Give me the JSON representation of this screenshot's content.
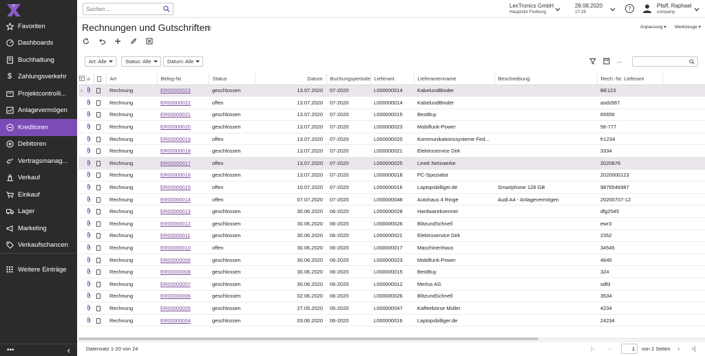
{
  "sidebar": {
    "items": [
      {
        "label": "Favoriten",
        "icon": "star-icon",
        "active": false
      },
      {
        "label": "Dashboards",
        "icon": "dashboard-icon",
        "active": false
      },
      {
        "label": "Buchhaltung",
        "icon": "ledger-icon",
        "active": false
      },
      {
        "label": "Zahlungsverkehr",
        "icon": "dollar-icon",
        "active": false
      },
      {
        "label": "Projektcontrolli...",
        "icon": "projects-icon",
        "active": false
      },
      {
        "label": "Anlagevermögen",
        "icon": "assets-icon",
        "active": false
      },
      {
        "label": "Kreditoren",
        "icon": "minus-circle-icon",
        "active": true
      },
      {
        "label": "Debitoren",
        "icon": "plus-circle-icon",
        "active": false
      },
      {
        "label": "Vertragsmanag...",
        "icon": "contract-icon",
        "active": false
      },
      {
        "label": "Verkauf",
        "icon": "sales-icon",
        "active": false
      },
      {
        "label": "Einkauf",
        "icon": "cart-icon",
        "active": false
      },
      {
        "label": "Lager",
        "icon": "truck-icon",
        "active": false
      },
      {
        "label": "Marketing",
        "icon": "megaphone-icon",
        "active": false
      },
      {
        "label": "Verkaufschancen",
        "icon": "tag-icon",
        "active": false
      }
    ],
    "more_label": "Weitere Einträge",
    "bottom_dots": "•••",
    "collapse": "‹"
  },
  "topbar": {
    "search_placeholder": "Suchen ...",
    "company": "LexTronics GmbH",
    "branch": "Hauptsitz Freiburg",
    "date": "28.08.2020",
    "time": "17:25",
    "help": "?",
    "user_name": "Pfaff, Raphael",
    "user_company": "company"
  },
  "page": {
    "title": "Rechnungen und Gutschriften",
    "star": "☆",
    "anpassung": "Anpassung",
    "werkzeuge": "Werkzeuge"
  },
  "filters": {
    "art": "Art: Alle",
    "status": "Status: Alle",
    "datum": "Datum: Alle"
  },
  "table": {
    "columns": [
      "Art",
      "Beleg-Nr.",
      "Status",
      "Datum",
      "Buchungsperiode",
      "Lieferant",
      "Lieferantenname",
      "Beschreibung",
      "Rech.-Nr. Lieferant"
    ],
    "rows": [
      {
        "art": "Rechnung",
        "beleg": "ER00000023",
        "status": "geschlossen",
        "datum": "13.07.2020",
        "periode": "07-2020",
        "lieferant": "L000000014",
        "name": "KabelundBinder",
        "beschreibung": "",
        "rechnr": "BE123",
        "sel": true
      },
      {
        "art": "Rechnung",
        "beleg": "ER00000022",
        "status": "offen",
        "datum": "13.07.2020",
        "periode": "07-2020",
        "lieferant": "L000000014",
        "name": "KabelundBinder",
        "beschreibung": "",
        "rechnr": "asds567",
        "sel": false
      },
      {
        "art": "Rechnung",
        "beleg": "ER00000021",
        "status": "geschlossen",
        "datum": "13.07.2020",
        "periode": "07-2020",
        "lieferant": "L000000015",
        "name": "BestBuy",
        "beschreibung": "",
        "rechnr": "65656",
        "sel": false
      },
      {
        "art": "Rechnung",
        "beleg": "ER00000020",
        "status": "geschlossen",
        "datum": "13.07.2020",
        "periode": "07-2020",
        "lieferant": "L000000023",
        "name": "Mobilfunk-Power",
        "beschreibung": "",
        "rechnr": "56-777",
        "sel": false
      },
      {
        "art": "Rechnung",
        "beleg": "ER00000019",
        "status": "offen",
        "datum": "13.07.2020",
        "periode": "07-2020",
        "lieferant": "L000000020",
        "name": "Kommunikationssysteme Fede...",
        "beschreibung": "",
        "rechnr": "fr1234",
        "sel": false
      },
      {
        "art": "Rechnung",
        "beleg": "ER00000018",
        "status": "geschlossen",
        "datum": "13.07.2020",
        "periode": "07-2020",
        "lieferant": "L000000021",
        "name": "Elektroservice Dirk",
        "beschreibung": "",
        "rechnr": "3334",
        "sel": false
      },
      {
        "art": "Rechnung",
        "beleg": "ER00000017",
        "status": "offen",
        "datum": "13.07.2020",
        "periode": "07-2020",
        "lieferant": "L000000025",
        "name": "Line6 Netzwerke",
        "beschreibung": "",
        "rechnr": "2020876",
        "sel": true
      },
      {
        "art": "Rechnung",
        "beleg": "ER00000016",
        "status": "geschlossen",
        "datum": "13.07.2020",
        "periode": "07-2020",
        "lieferant": "L000000018",
        "name": "PC-Spezialist",
        "beschreibung": "",
        "rechnr": "2020000123",
        "sel": false
      },
      {
        "art": "Rechnung",
        "beleg": "ER00000015",
        "status": "offen",
        "datum": "10.07.2020",
        "periode": "07-2020",
        "lieferant": "L000000016",
        "name": "Laptopsbilliger.de",
        "beschreibung": "Smartphone 128 GB",
        "rechnr": "9876546987",
        "sel": false
      },
      {
        "art": "Rechnung",
        "beleg": "ER00000014",
        "status": "offen",
        "datum": "07.07.2020",
        "periode": "07-2020",
        "lieferant": "L000000048",
        "name": "Autohaus 4 Ringe",
        "beschreibung": "Audi A4 - Anlagevermögen",
        "rechnr": "20200707-12",
        "sel": false
      },
      {
        "art": "Rechnung",
        "beleg": "ER00000013",
        "status": "geschlossen",
        "datum": "30.06.2020",
        "periode": "06-2020",
        "lieferant": "L000000028",
        "name": "Hardwarekoenner",
        "beschreibung": "",
        "rechnr": "dfg2545",
        "sel": false
      },
      {
        "art": "Rechnung",
        "beleg": "ER00000012",
        "status": "geschlossen",
        "datum": "30.06.2020",
        "periode": "06-2020",
        "lieferant": "L000000026",
        "name": "BlitzundSchnell",
        "beschreibung": "",
        "rechnr": "ewr3",
        "sel": false
      },
      {
        "art": "Rechnung",
        "beleg": "ER00000011",
        "status": "geschlossen",
        "datum": "30.06.2020",
        "periode": "06-2020",
        "lieferant": "L000000021",
        "name": "Elektroservice Dirk",
        "beschreibung": "",
        "rechnr": "2352",
        "sel": false
      },
      {
        "art": "Rechnung",
        "beleg": "ER00000010",
        "status": "offen",
        "datum": "30.06.2020",
        "periode": "06-2020",
        "lieferant": "L000000017",
        "name": "Maschinenhaus",
        "beschreibung": "",
        "rechnr": "34545",
        "sel": false
      },
      {
        "art": "Rechnung",
        "beleg": "ER00000009",
        "status": "geschlossen",
        "datum": "30.06.2020",
        "periode": "06-2020",
        "lieferant": "L000000023",
        "name": "Mobilfunk-Power",
        "beschreibung": "",
        "rechnr": "4645",
        "sel": false
      },
      {
        "art": "Rechnung",
        "beleg": "ER00000008",
        "status": "geschlossen",
        "datum": "30.06.2020",
        "periode": "06-2020",
        "lieferant": "L000000015",
        "name": "BestBuy",
        "beschreibung": "",
        "rechnr": "324",
        "sel": false
      },
      {
        "art": "Rechnung",
        "beleg": "ER00000007",
        "status": "geschlossen",
        "datum": "30.06.2020",
        "periode": "06-2020",
        "lieferant": "L000000012",
        "name": "Merlus AG",
        "beschreibung": "",
        "rechnr": "sdfd",
        "sel": false
      },
      {
        "art": "Rechnung",
        "beleg": "ER00000006",
        "status": "geschlossen",
        "datum": "02.06.2020",
        "periode": "06-2020",
        "lieferant": "L000000026",
        "name": "BlitzundSchnell",
        "beschreibung": "",
        "rechnr": "3534",
        "sel": false
      },
      {
        "art": "Rechnung",
        "beleg": "ER00000005",
        "status": "geschlossen",
        "datum": "27.05.2020",
        "periode": "05-2020",
        "lieferant": "L000000047",
        "name": "Kaffeebörse Müller",
        "beschreibung": "",
        "rechnr": "4234",
        "sel": false
      },
      {
        "art": "Rechnung",
        "beleg": "ER00000004",
        "status": "geschlossen",
        "datum": "03.06.2020",
        "periode": "06-2020",
        "lieferant": "L000000016",
        "name": "Laptopsbilliger.de",
        "beschreibung": "",
        "rechnr": "24234",
        "sel": false
      }
    ]
  },
  "footer": {
    "records": "Datensatz 1-20 von 24",
    "page": "1",
    "pages_label": "von 2 Seiten"
  },
  "colors": {
    "sidebar_bg": "#2b2b2b",
    "accent": "#7b4bb6",
    "selected_row": "#ebe6ee"
  }
}
